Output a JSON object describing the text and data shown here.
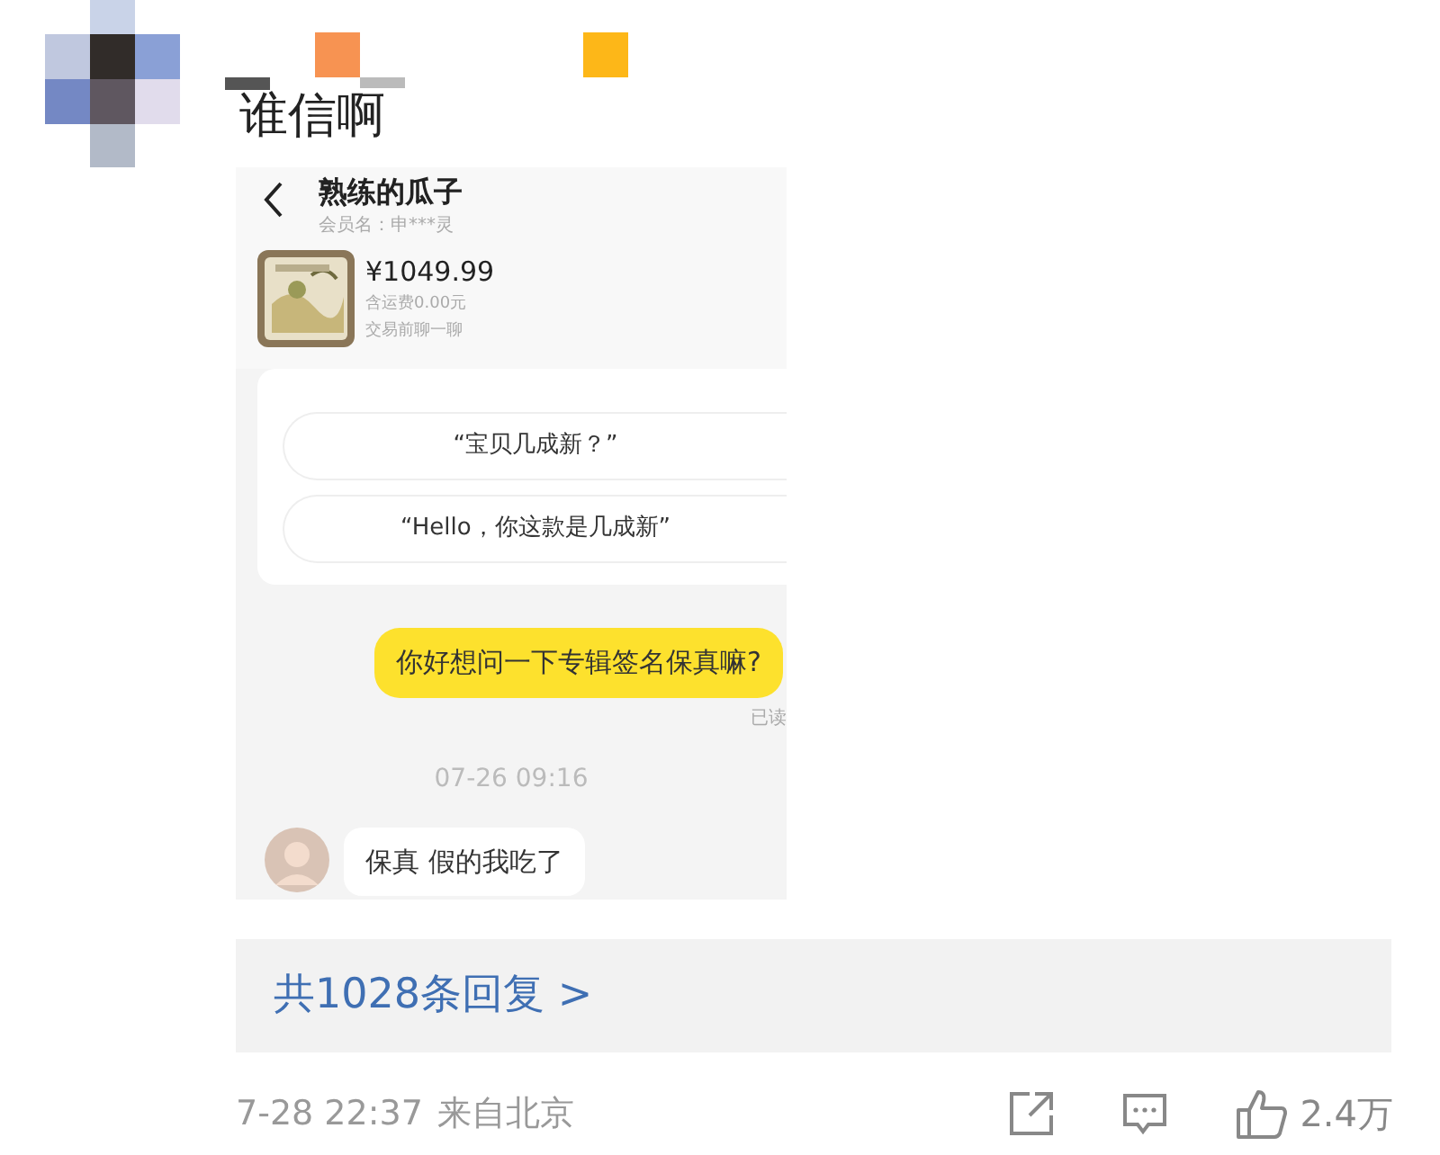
{
  "comment": {
    "text": "谁信啊"
  },
  "chat": {
    "title": "熟练的瓜子",
    "member": "会员名：申***灵",
    "price": "¥1049.99",
    "shipping": "含运费0.00元",
    "hint": "交易前聊一聊",
    "quick_replies": [
      "“宝贝几成新？”",
      "“Hello，你这款是几成新”"
    ],
    "messages": [
      {
        "kind": "outgoing",
        "text": "你好想问一下专辑签名保真嘛?",
        "status": "已读"
      },
      {
        "kind": "time",
        "text": "07-26 09:16"
      },
      {
        "kind": "incoming",
        "text": "保真 假的我吃了"
      }
    ]
  },
  "replies": {
    "label": "共1028条回复 >"
  },
  "footer": {
    "time": "7-28 22:37",
    "location": "来自北京",
    "likes": "2.4万"
  }
}
